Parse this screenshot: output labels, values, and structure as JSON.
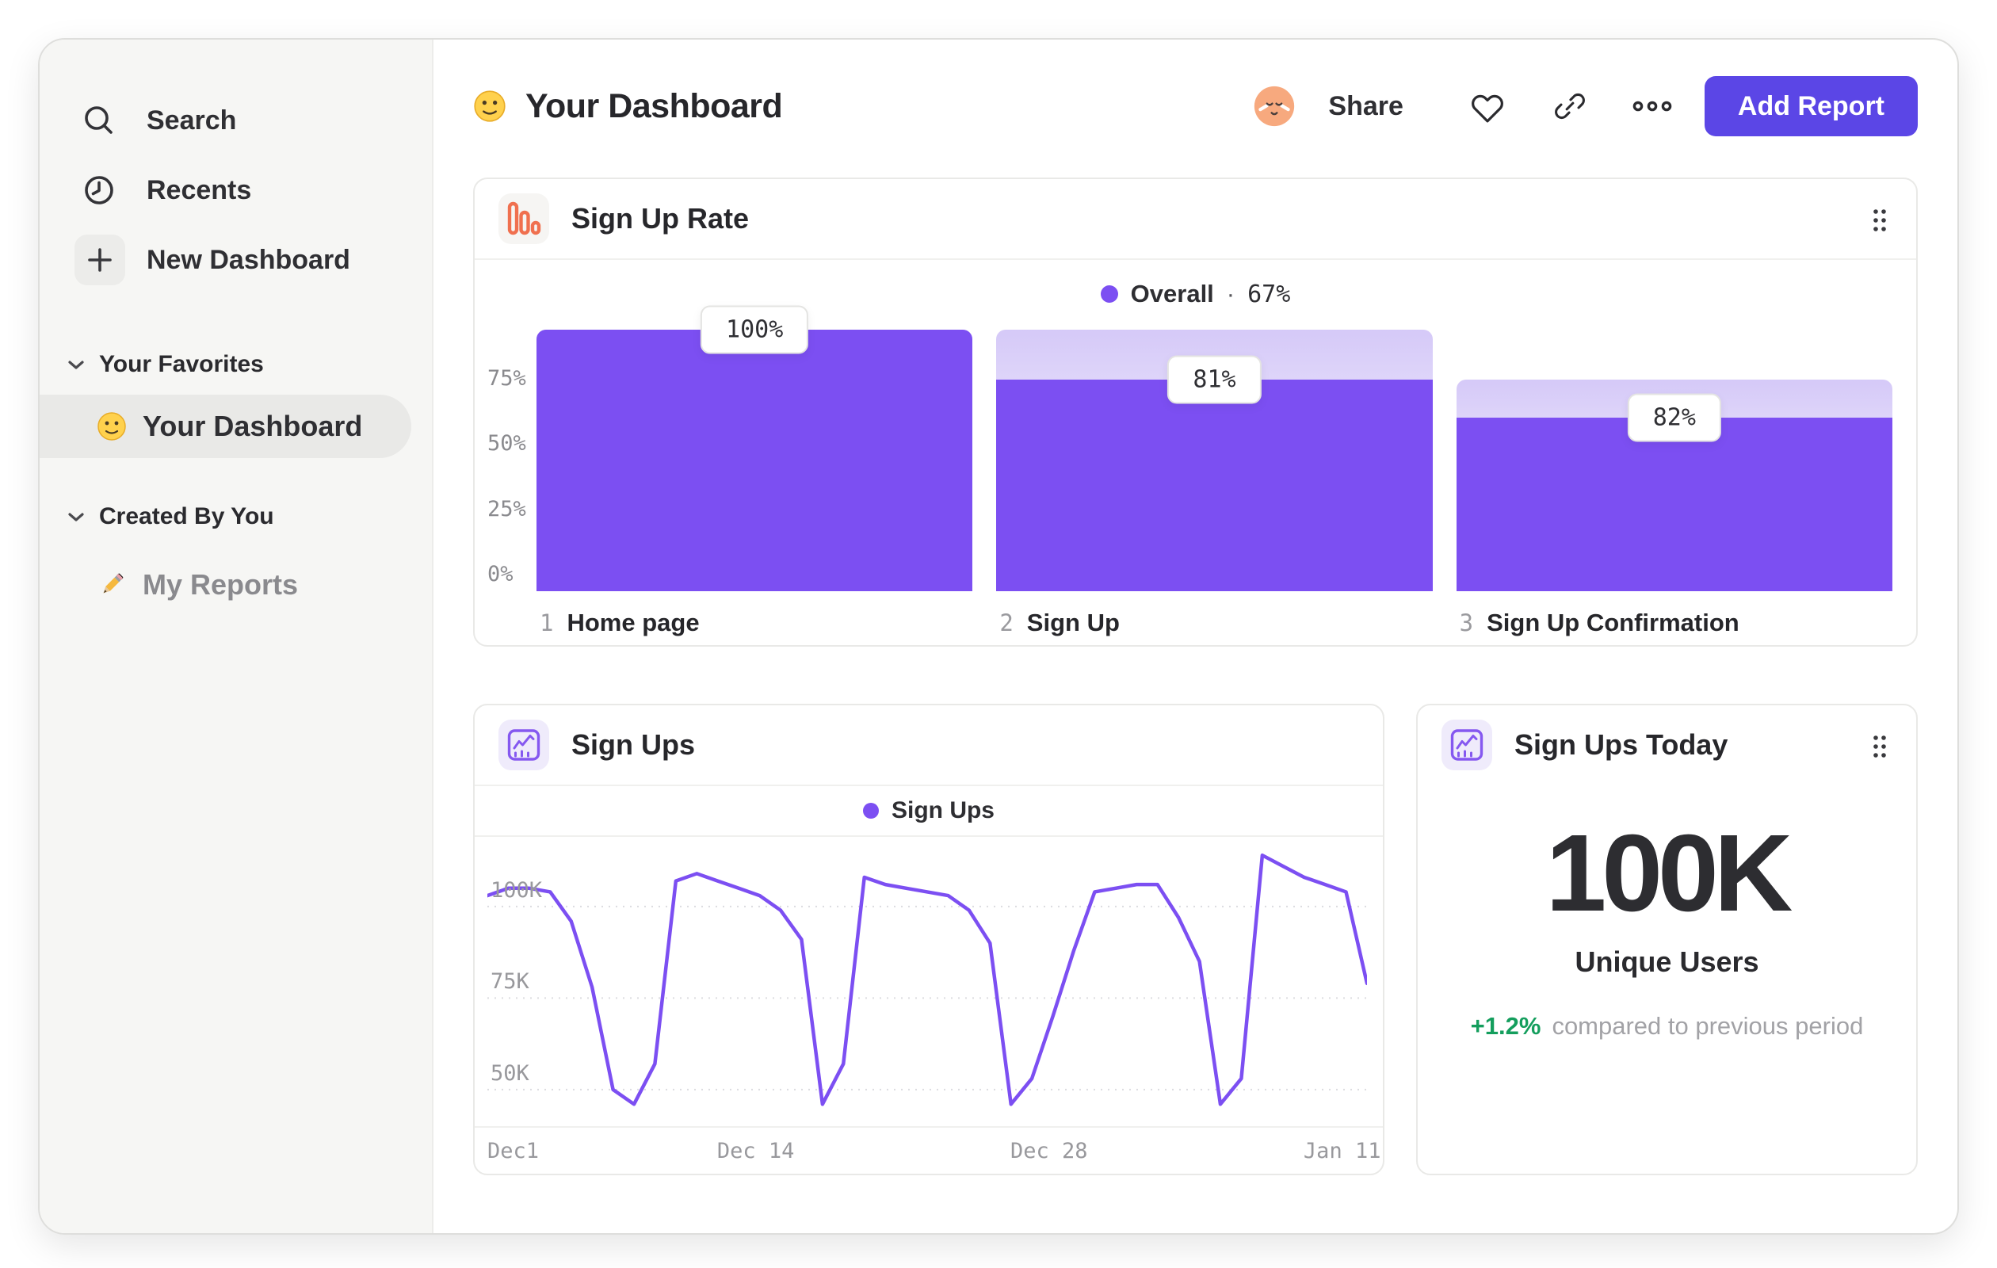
{
  "colors": {
    "accent_purple": "#7C4FF2",
    "button_purple": "#5B46E6",
    "funnel_icon_orange": "#F0704F",
    "positive_green": "#149E5D",
    "sidebar_bg": "#F6F6F4"
  },
  "sidebar": {
    "top_items": [
      {
        "icon": "search-icon",
        "label": "Search"
      },
      {
        "icon": "clock-icon",
        "label": "Recents"
      },
      {
        "icon": "plus-icon",
        "label": "New Dashboard"
      }
    ],
    "sections": [
      {
        "header": "Your Favorites",
        "items": [
          {
            "icon": "smiley-emoji",
            "label": "Your Dashboard",
            "selected": true
          }
        ]
      },
      {
        "header": "Created By You",
        "items": [
          {
            "icon": "pencil-emoji",
            "label": "My Reports",
            "selected": false
          }
        ]
      }
    ]
  },
  "header": {
    "icon": "smiley-emoji",
    "title": "Your Dashboard",
    "share_label": "Share",
    "add_report_label": "Add Report"
  },
  "chart_data": [
    {
      "type": "bar",
      "variant": "funnel",
      "title": "Sign Up Rate",
      "legend": {
        "series": "Overall",
        "separator": "·",
        "value": "67%",
        "position": "top-center"
      },
      "y_axis": {
        "max_pct": 100,
        "ticks": [
          {
            "label": "75%",
            "pct": 75
          },
          {
            "label": "50%",
            "pct": 50
          },
          {
            "label": "25%",
            "pct": 25
          },
          {
            "label": "0%",
            "pct": 0
          }
        ]
      },
      "steps": [
        {
          "step": "1",
          "label": "Home page",
          "value_label": "100%",
          "conversion_from_previous_pct": 100,
          "overall_from_top_pct": 100,
          "ghost_from_top_pct": 100
        },
        {
          "step": "2",
          "label": "Sign Up",
          "value_label": "81%",
          "conversion_from_previous_pct": 81,
          "overall_from_top_pct": 81,
          "ghost_from_top_pct": 100
        },
        {
          "step": "3",
          "label": "Sign Up Confirmation",
          "value_label": "82%",
          "conversion_from_previous_pct": 82,
          "overall_from_top_pct": 66.4,
          "ghost_from_top_pct": 81
        }
      ]
    },
    {
      "type": "line",
      "title": "Sign Ups",
      "legend": {
        "series": "Sign Ups"
      },
      "unit": "K",
      "y_range": [
        40,
        116
      ],
      "y_ticks": [
        {
          "label": "100K",
          "value": 100
        },
        {
          "label": "75K",
          "value": 75
        },
        {
          "label": "50K",
          "value": 50
        }
      ],
      "x_ticks": [
        {
          "label": "Dec1",
          "fraction": 0
        },
        {
          "label": "Dec 14",
          "fraction": 0.3095
        },
        {
          "label": "Dec 28",
          "fraction": 0.6429
        },
        {
          "label": "Jan 11",
          "fraction": 0.9762
        }
      ],
      "values_thousands": [
        103,
        105,
        105,
        104,
        96,
        78,
        50,
        46,
        57,
        107,
        109,
        107,
        105,
        103,
        99,
        91,
        46,
        57,
        108,
        106,
        105,
        104,
        103,
        99,
        90,
        46,
        53,
        70,
        88,
        104,
        105,
        106,
        106,
        97,
        85,
        46,
        53,
        114,
        111,
        108,
        106,
        104,
        79
      ]
    },
    {
      "type": "metric",
      "title": "Sign Ups Today",
      "value": "100K",
      "label": "Unique Users",
      "delta": "+1.2%",
      "delta_direction": "up",
      "comparison": "compared to previous period"
    }
  ]
}
